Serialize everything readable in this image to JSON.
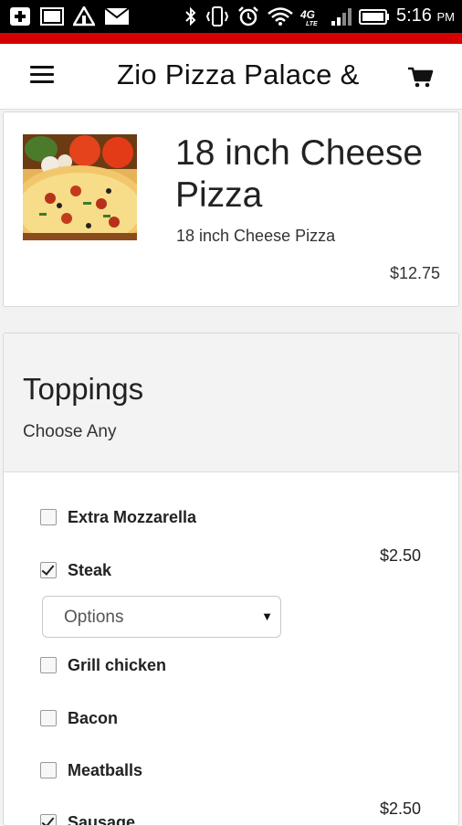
{
  "status_bar": {
    "time": "5:16",
    "ampm": "PM"
  },
  "app": {
    "title": "Zio Pizza Palace &",
    "menu_icon": "hamburger-menu-icon",
    "cart_icon": "shopping-cart-icon",
    "accent_color": "#d50000"
  },
  "product": {
    "title": "18 inch Cheese Pizza",
    "description": "18 inch Cheese Pizza",
    "price": "$12.75"
  },
  "toppings": {
    "title": "Toppings",
    "subtitle": "Choose Any",
    "items": [
      {
        "label": "Extra Mozzarella",
        "checked": false,
        "price": ""
      },
      {
        "label": "Steak",
        "checked": true,
        "price": "$2.50"
      },
      {
        "label": "Grill chicken",
        "checked": false,
        "price": ""
      },
      {
        "label": "Bacon",
        "checked": false,
        "price": ""
      },
      {
        "label": "Meatballs",
        "checked": false,
        "price": ""
      },
      {
        "label": "Sausage",
        "checked": true,
        "price": "$2.50"
      }
    ],
    "options_select": {
      "value": "Options"
    }
  }
}
